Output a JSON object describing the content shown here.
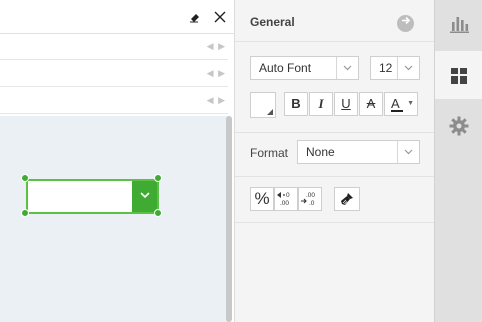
{
  "left": {
    "row_arrows": "◀ ▶"
  },
  "general": {
    "title": "General",
    "font": {
      "value": "Auto Font"
    },
    "size": {
      "value": "12"
    },
    "style_buttons": {
      "bold": "B",
      "italic": "I",
      "underline": "U",
      "strike": "A",
      "font_color": "A"
    },
    "format": {
      "label": "Format",
      "value": "None"
    },
    "number_buttons": {
      "percent": "%"
    }
  },
  "rail": {
    "tabs": [
      "chart-icon",
      "layout-icon",
      "gear-icon"
    ]
  },
  "colors": {
    "accent_green": "#3fab33",
    "selection_border": "#5cc045",
    "font_color_bar": "#222222"
  }
}
